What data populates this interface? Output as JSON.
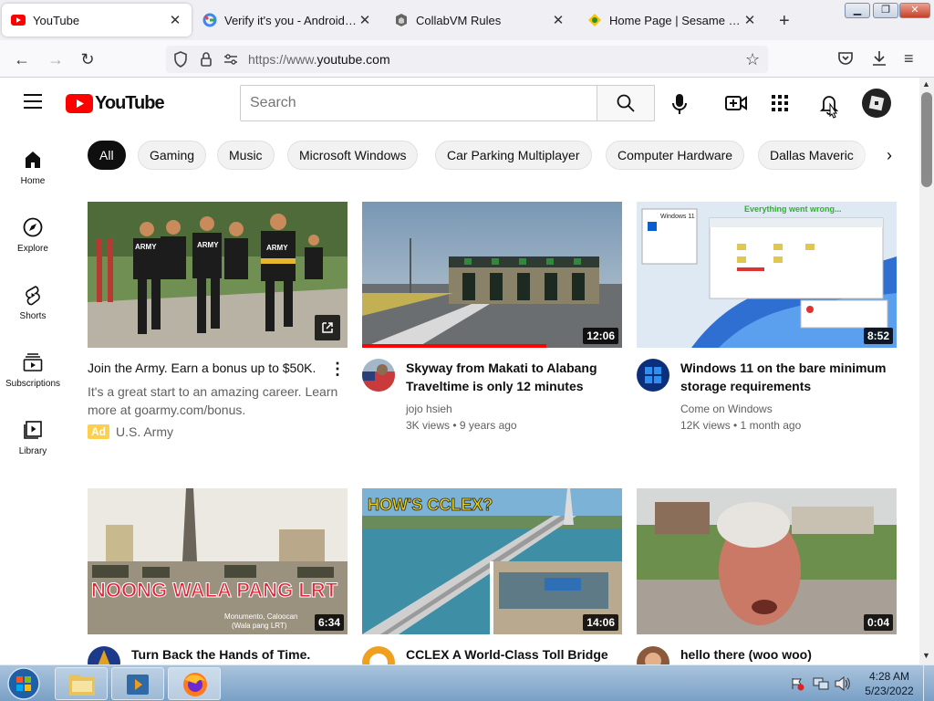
{
  "browser": {
    "tabs": [
      {
        "title": "YouTube"
      },
      {
        "title": "Verify it's you - Android - Go"
      },
      {
        "title": "CollabVM Rules"
      },
      {
        "title": "Home Page | Sesame Street |"
      }
    ],
    "url_prefix": "https://www.",
    "url_domain": "youtube.com"
  },
  "youtube": {
    "logo_text": "YouTube",
    "search_placeholder": "Search",
    "sidebar": [
      {
        "label": "Home"
      },
      {
        "label": "Explore"
      },
      {
        "label": "Shorts"
      },
      {
        "label": "Subscriptions"
      },
      {
        "label": "Library"
      }
    ],
    "chips": [
      "All",
      "Gaming",
      "Music",
      "Microsoft Windows",
      "Car Parking Multiplayer",
      "Computer Hardware",
      "Dallas Maveric"
    ],
    "videos": [
      {
        "title": "Join the Army. Earn a bonus up to $50K.",
        "desc": "It's a great start to an amazing career. Learn more at goarmy.com/bonus.",
        "ad_label": "Ad",
        "channel": "U.S. Army"
      },
      {
        "title": "Skyway from Makati to Alabang Traveltime is only 12 minutes",
        "channel": "jojo hsieh",
        "stats": "3K views • 9 years ago",
        "duration": "12:06"
      },
      {
        "title": "Windows 11 on the bare minimum storage requirements",
        "channel": "Come on Windows",
        "stats": "12K views • 1 month ago",
        "duration": "8:52"
      },
      {
        "title": "Turn Back the Hands of Time.",
        "duration": "6:34",
        "overlay": "NOONG WALA PANG LRT",
        "caption1": "Monumento, Caloocan",
        "caption2": "(Wala pang LRT)"
      },
      {
        "title": "CCLEX A World-Class Toll Bridge",
        "duration": "14:06",
        "overlay": "HOW'S CCLEX?"
      },
      {
        "title": "hello there (woo woo)",
        "duration": "0:04"
      }
    ],
    "win11_thumb": {
      "label": "Windows 11",
      "overlay": "Everything went wrong..."
    },
    "army_shirt": "ARMY"
  },
  "taskbar": {
    "time": "4:28 AM",
    "date": "5/23/2022"
  }
}
